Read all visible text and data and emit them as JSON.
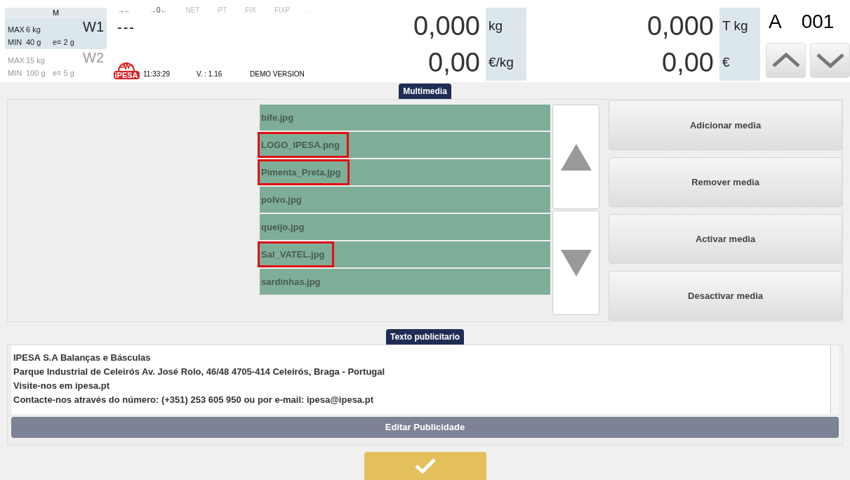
{
  "scale_panel": {
    "mode": "M",
    "scales": [
      {
        "name": "W1",
        "max_label": "MAX",
        "max": "6 kg",
        "min_label": "MIN",
        "min": "40 g",
        "e": "e= 2 g",
        "selected": true
      },
      {
        "name": "W2",
        "max_label": "MAX",
        "max": "15 kg",
        "min_label": "MIN",
        "min": "100 g",
        "e": "e= 5 g",
        "selected": false
      }
    ]
  },
  "indicators": [
    {
      "label": "→←",
      "on": true
    },
    {
      "label": "→0←",
      "on": true
    },
    {
      "label": "NET",
      "on": false
    },
    {
      "label": "PT",
      "on": false
    },
    {
      "label": "FIX",
      "on": false
    },
    {
      "label": "FIXP",
      "on": false
    },
    {
      "label": ".",
      "on": false
    }
  ],
  "weight_status": "---",
  "logo": {
    "text": "iPESA"
  },
  "time": "11:33:29",
  "version": "V. : 1.16",
  "mode_label": "DEMO VERSION",
  "readouts": [
    {
      "value": "0,000",
      "unit": "kg"
    },
    {
      "value": "0,00",
      "unit": "€/kg"
    }
  ],
  "totals": [
    {
      "value": "0,000",
      "unit": "T kg"
    },
    {
      "value": "0,00",
      "unit": "€"
    }
  ],
  "operator": {
    "letter": "A",
    "number": "001"
  },
  "multimedia": {
    "title": "Multimedia",
    "files": [
      {
        "name": "bife.jpg",
        "highlighted": false
      },
      {
        "name": "LOGO_IPESA.png",
        "highlighted": true
      },
      {
        "name": "Pimenta_Preta.jpg",
        "highlighted": true
      },
      {
        "name": "polvo.jpg",
        "highlighted": false
      },
      {
        "name": "queijo.jpg",
        "highlighted": false
      },
      {
        "name": "Sal_VATEL.jpg",
        "highlighted": true
      },
      {
        "name": "sardinhas.jpg",
        "highlighted": false
      }
    ],
    "actions": [
      "Adicionar media",
      "Remover media",
      "Activar media",
      "Desactivar media"
    ]
  },
  "advertising": {
    "title": "Texto publicitario",
    "lines": [
      "IPESA S.A Balanças e Básculas",
      "Parque Industrial de Celeirós Av. José Rolo, 46/48 4705-414 Celeirós, Braga - Portugal",
      "Visite-nos em ipesa.pt",
      "Contacte-nos através do número: (+351) 253 605 950 ou por e-mail: ipesa@ipesa.pt"
    ],
    "edit_button": "Editar Publicidade"
  }
}
